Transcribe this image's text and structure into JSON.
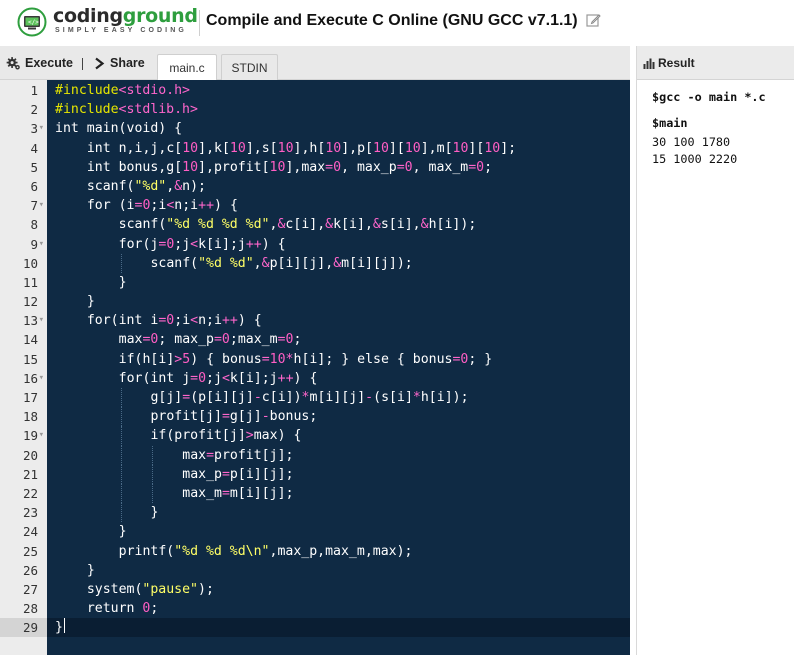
{
  "header": {
    "logo_text_part1": "coding",
    "logo_text_part2": "ground",
    "logo_tagline": "SIMPLY EASY CODING",
    "title": "Compile and Execute C Online (GNU GCC v7.1.1)"
  },
  "toolbar": {
    "execute_label": "Execute",
    "share_label": "Share",
    "tabs": [
      "main.c",
      "STDIN"
    ],
    "active_tab": "main.c"
  },
  "editor": {
    "language": "c",
    "active_line": 29,
    "colors": {
      "background": "#0f2a44",
      "number": "#ff5ec4",
      "string": "#ffff66",
      "include": "#ff66cc",
      "preprocessor": "#e6e600"
    },
    "fold_lines": [
      3,
      7,
      9,
      13,
      16,
      19
    ],
    "lines": [
      "#include<stdio.h>",
      "#include<stdlib.h>",
      "int main(void) {",
      "    int n,i,j,c[10],k[10],s[10],h[10],p[10][10],m[10][10];",
      "    int bonus,g[10],profit[10],max=0, max_p=0, max_m=0;",
      "    scanf(\"%d\",&n);",
      "    for (i=0;i<n;i++) {",
      "        scanf(\"%d %d %d %d\",&c[i],&k[i],&s[i],&h[i]);",
      "        for(j=0;j<k[i];j++) {",
      "            scanf(\"%d %d\",&p[i][j],&m[i][j]);",
      "        }",
      "    }",
      "    for(int i=0;i<n;i++) {",
      "        max=0; max_p=0;max_m=0;",
      "        if(h[i]>5) { bonus=10*h[i]; } else { bonus=0; }",
      "        for(int j=0;j<k[i];j++) {",
      "            g[j]=(p[i][j]-c[i])*m[i][j]-(s[i]*h[i]);",
      "            profit[j]=g[j]-bonus;",
      "            if(profit[j]>max) {",
      "                max=profit[j];",
      "                max_p=p[i][j];",
      "                max_m=m[i][j];",
      "            }",
      "        }",
      "        printf(\"%d %d %d\\n\",max_p,max_m,max);",
      "    }",
      "    system(\"pause\");",
      "    return 0;",
      "}"
    ]
  },
  "result": {
    "title": "Result",
    "command": "$gcc -o main *.c",
    "run": "$main",
    "output": [
      "30 100 1780",
      "15 1000 2220"
    ]
  },
  "icons": {
    "execute": "gear-icon",
    "share": "share-chevron-icon",
    "edit": "edit-icon",
    "result": "bar-chart-icon",
    "logo": "codingground-logo"
  }
}
